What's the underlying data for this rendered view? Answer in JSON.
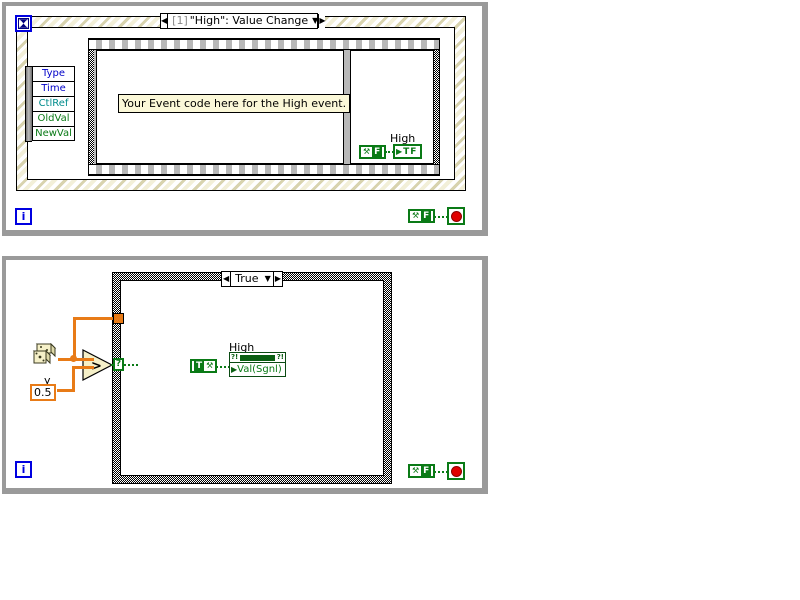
{
  "panels": [
    {
      "id": "event-structure-panel",
      "event_selector": {
        "index": "[1]",
        "label": "\"High\": Value Change",
        "left_arrow": "◀",
        "right_arrow": "▶",
        "chevron": "▼"
      },
      "timeout_terminal_icon": "hourglass-icon",
      "timeout_glyph": "⌛",
      "event_data_node": {
        "terminals": [
          {
            "label": "Type",
            "color": "#0000c8"
          },
          {
            "label": "Time",
            "color": "#0000c8"
          },
          {
            "label": "CtlRef",
            "color": "#008c8c"
          },
          {
            "label": "OldVal",
            "color": "#0a7a16"
          },
          {
            "label": "NewVal",
            "color": "#0a7a16"
          }
        ]
      },
      "comment": "Your Event code here for the High event.",
      "bool_constant": {
        "glyph": "⚒",
        "letter": "F"
      },
      "bool_terminal": {
        "arrow": "▶",
        "label": "TF"
      },
      "bool_terminal_label": "High",
      "stop_constant": {
        "glyph": "⚒",
        "letter": "F"
      },
      "stop_button_name": "stop-button",
      "iteration_terminal": "i"
    },
    {
      "id": "case-structure-panel",
      "case_selector": {
        "label": "True",
        "left_arrow": "◀",
        "right_arrow": "▶",
        "chevron": "▼"
      },
      "random_number_icon": "dice-random-number-icon",
      "comparison_icon": "greater-than-icon",
      "comparison_symbol": ">",
      "numeric_constant": {
        "label": "y",
        "value": "0.5"
      },
      "selector_terminal_glyph": "?",
      "bool_constant": {
        "letter": "T",
        "glyph": "⚒"
      },
      "property_node": {
        "label": "High",
        "property": "Val(Sgnl)",
        "header_left_glyph": "?!",
        "header_right_glyph": "?!",
        "input_arrow": "▶"
      },
      "stop_constant": {
        "glyph": "⚒",
        "letter": "F"
      },
      "stop_button_name": "stop-button",
      "iteration_terminal": "i"
    }
  ],
  "colors": {
    "boolean_green": "#0a7a16",
    "numeric_orange": "#e87b17",
    "refnum_blue": "#0000c8",
    "ctlref_teal": "#008c8c",
    "stop_red": "#e00000",
    "comment_yellow": "#fbf8d8"
  }
}
